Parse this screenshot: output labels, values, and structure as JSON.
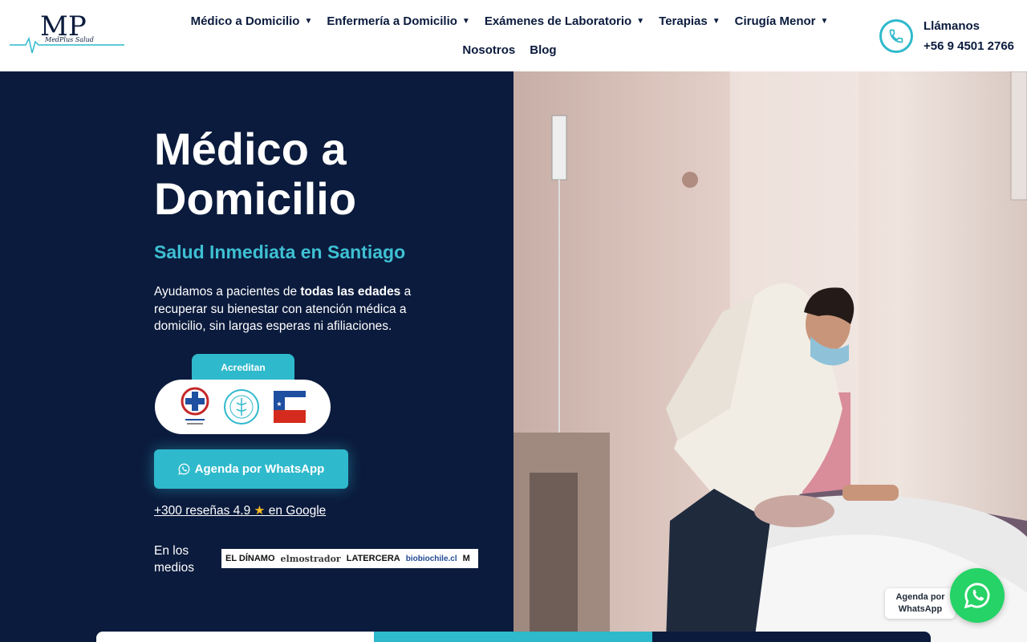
{
  "header": {
    "logo_text": "MP",
    "logo_tagline": "MedPlus Salud",
    "nav_row1": [
      {
        "label": "Médico a Domicilio"
      },
      {
        "label": "Enfermería a Domicilio"
      },
      {
        "label": "Exámenes de Laboratorio"
      },
      {
        "label": "Terapias"
      },
      {
        "label": "Cirugía Menor"
      }
    ],
    "nav_row2": [
      {
        "label": "Nosotros"
      },
      {
        "label": "Blog"
      }
    ],
    "call_label": "Llámanos",
    "call_number": "+56 9 4501 2766"
  },
  "hero": {
    "title": "Médico a Domicilio",
    "subtitle": "Salud Inmediata en Santiago",
    "desc_pre": "Ayudamos a pacientes de ",
    "desc_bold": "todas las edades",
    "desc_post": " a recuperar su bienestar con atención médica a domicilio, sin largas esperas ni afiliaciones.",
    "accredit_label": "Acreditan",
    "accredit_logos": [
      "colegio-medico-logo",
      "sociedad-logo",
      "gobierno-de-chile-logo"
    ],
    "whatsapp_button": "Agenda por WhatsApp",
    "reviews_pre": "+300 reseñas 4.9",
    "reviews_star": "★",
    "reviews_post": " en Google",
    "media_label": "En los medios",
    "media_outlets": [
      "EL DÍNAMO",
      "elmostrador",
      "LATERCERA",
      "biobiochile.cl",
      "M"
    ]
  },
  "floating": {
    "whatsapp_label": "Agenda por WhatsApp"
  },
  "colors": {
    "navy": "#0b1b3d",
    "accent": "#2fb9cc",
    "whatsapp": "#25d366"
  }
}
